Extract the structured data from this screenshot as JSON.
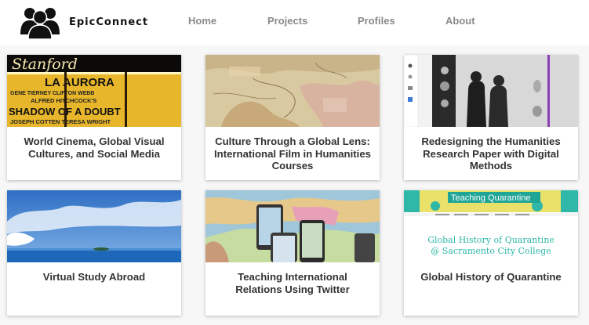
{
  "brand": {
    "name": "EpicConnect",
    "logo_icon": "people-group-icon"
  },
  "nav": {
    "links": [
      "Home",
      "Projects",
      "Profiles",
      "About"
    ]
  },
  "cards": [
    {
      "title": "World Cinema, Global Visual Cultures, and Social Media",
      "image": "theater-marquee-photo"
    },
    {
      "title": "Culture Through a Global Lens: International Film in Humanities Courses",
      "image": "antique-map-photo"
    },
    {
      "title": "Redesigning the Humanities Research Paper with Digital Methods",
      "image": "gallery-visitors-photo"
    },
    {
      "title": "Virtual Study Abroad",
      "image": "ocean-sky-photo"
    },
    {
      "title": "Teaching International Relations Using Twitter",
      "image": "phones-over-map-photo"
    },
    {
      "title": "Global History of Quarantine",
      "image": "website-screenshot"
    }
  ],
  "card_images": {
    "marquee_lines": [
      "Stanford",
      "LA AURORA",
      "GENE TIERNEY  CLIFTON WEBB",
      "ALFRED HITCHCOCK'S",
      "SHADOW OF A DOUBT",
      "JOSEPH COTTEN  TERESA WRIGHT"
    ],
    "quarantine_site": {
      "banner_title": "Teaching Quarantine",
      "heading_line1": "Global History of Quarantine",
      "heading_line2": "@ Sacramento City College"
    }
  }
}
